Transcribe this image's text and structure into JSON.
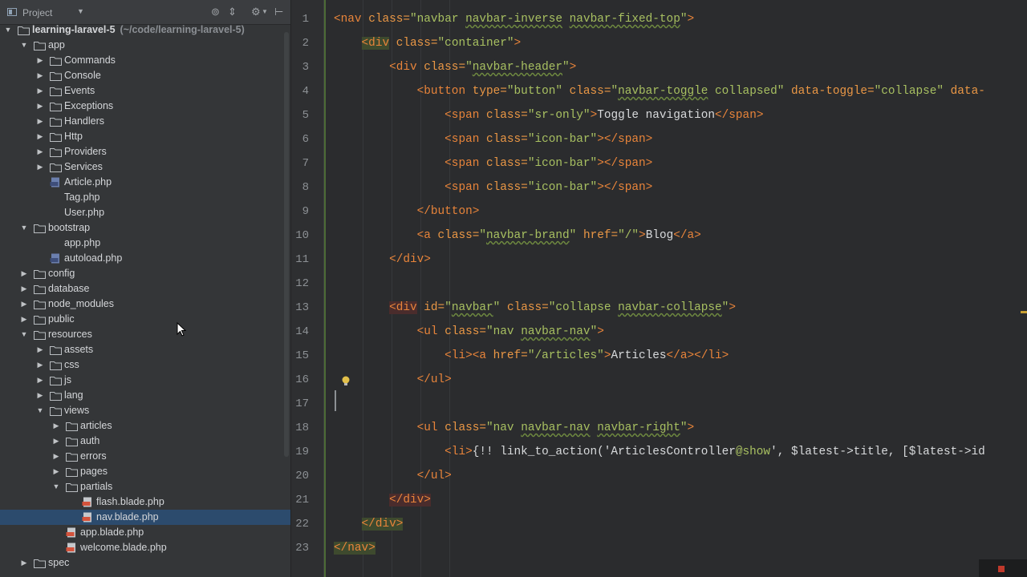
{
  "panel": {
    "title": "Project"
  },
  "tree": [
    {
      "label": "learning-laravel-5",
      "hint": "(~/code/learning-laravel-5)",
      "depth": 0,
      "arrow": "down",
      "icon": "folder",
      "bold": true
    },
    {
      "label": "app",
      "depth": 1,
      "arrow": "down",
      "icon": "folder"
    },
    {
      "label": "Commands",
      "depth": 2,
      "arrow": "right",
      "icon": "folder"
    },
    {
      "label": "Console",
      "depth": 2,
      "arrow": "right",
      "icon": "folder"
    },
    {
      "label": "Events",
      "depth": 2,
      "arrow": "right",
      "icon": "folder"
    },
    {
      "label": "Exceptions",
      "depth": 2,
      "arrow": "right",
      "icon": "folder"
    },
    {
      "label": "Handlers",
      "depth": 2,
      "arrow": "right",
      "icon": "folder"
    },
    {
      "label": "Http",
      "depth": 2,
      "arrow": "right",
      "icon": "folder"
    },
    {
      "label": "Providers",
      "depth": 2,
      "arrow": "right",
      "icon": "folder"
    },
    {
      "label": "Services",
      "depth": 2,
      "arrow": "right",
      "icon": "folder"
    },
    {
      "label": "Article.php",
      "depth": 2,
      "arrow": "",
      "icon": "php"
    },
    {
      "label": "Tag.php",
      "depth": 2,
      "arrow": "",
      "icon": ""
    },
    {
      "label": "User.php",
      "depth": 2,
      "arrow": "",
      "icon": ""
    },
    {
      "label": "bootstrap",
      "depth": 1,
      "arrow": "down",
      "icon": "folder"
    },
    {
      "label": "app.php",
      "depth": 2,
      "arrow": "",
      "icon": ""
    },
    {
      "label": "autoload.php",
      "depth": 2,
      "arrow": "",
      "icon": "php"
    },
    {
      "label": "config",
      "depth": 1,
      "arrow": "right",
      "icon": "folder"
    },
    {
      "label": "database",
      "depth": 1,
      "arrow": "right",
      "icon": "folder"
    },
    {
      "label": "node_modules",
      "depth": 1,
      "arrow": "right",
      "icon": "folder"
    },
    {
      "label": "public",
      "depth": 1,
      "arrow": "right",
      "icon": "folder"
    },
    {
      "label": "resources",
      "depth": 1,
      "arrow": "down",
      "icon": "folder"
    },
    {
      "label": "assets",
      "depth": 2,
      "arrow": "right",
      "icon": "folder"
    },
    {
      "label": "css",
      "depth": 2,
      "arrow": "right",
      "icon": "folder"
    },
    {
      "label": "js",
      "depth": 2,
      "arrow": "right",
      "icon": "folder"
    },
    {
      "label": "lang",
      "depth": 2,
      "arrow": "right",
      "icon": "folder"
    },
    {
      "label": "views",
      "depth": 2,
      "arrow": "down",
      "icon": "folder"
    },
    {
      "label": "articles",
      "depth": 3,
      "arrow": "right",
      "icon": "folder"
    },
    {
      "label": "auth",
      "depth": 3,
      "arrow": "right",
      "icon": "folder"
    },
    {
      "label": "errors",
      "depth": 3,
      "arrow": "right",
      "icon": "folder"
    },
    {
      "label": "pages",
      "depth": 3,
      "arrow": "right",
      "icon": "folder"
    },
    {
      "label": "partials",
      "depth": 3,
      "arrow": "down",
      "icon": "folder"
    },
    {
      "label": "flash.blade.php",
      "depth": 4,
      "arrow": "",
      "icon": "blade"
    },
    {
      "label": "nav.blade.php",
      "depth": 4,
      "arrow": "",
      "icon": "blade",
      "selected": true
    },
    {
      "label": "app.blade.php",
      "depth": 3,
      "arrow": "",
      "icon": "blade"
    },
    {
      "label": "welcome.blade.php",
      "depth": 3,
      "arrow": "",
      "icon": "blade"
    },
    {
      "label": "spec",
      "depth": 1,
      "arrow": "right",
      "icon": "folder"
    }
  ],
  "editor": {
    "line_numbers": [
      "1",
      "2",
      "3",
      "4",
      "5",
      "6",
      "7",
      "8",
      "9",
      "10",
      "11",
      "12",
      "13",
      "14",
      "15",
      "16",
      "17",
      "18",
      "19",
      "20",
      "21",
      "22",
      "23"
    ],
    "lines": [
      [
        [
          "tag",
          "<nav "
        ],
        [
          "attr",
          "class="
        ],
        [
          "val",
          "\"navbar "
        ],
        [
          "val",
          "navbar-inverse",
          "u"
        ],
        [
          "val",
          " "
        ],
        [
          "val",
          "navbar-fixed-top",
          "u"
        ],
        [
          "val",
          "\""
        ],
        [
          "tag",
          ">"
        ]
      ],
      [
        [
          "tag",
          "    <div",
          "hl-g"
        ],
        [
          "attr",
          " class="
        ],
        [
          "val",
          "\"container\""
        ],
        [
          "tag",
          ">"
        ]
      ],
      [
        [
          "tag",
          "        <div "
        ],
        [
          "attr",
          "class="
        ],
        [
          "val",
          "\""
        ],
        [
          "val",
          "navbar-header",
          "u"
        ],
        [
          "val",
          "\""
        ],
        [
          "tag",
          ">"
        ]
      ],
      [
        [
          "tag",
          "            <button "
        ],
        [
          "attr",
          "type="
        ],
        [
          "val",
          "\"button\" "
        ],
        [
          "attr",
          "class="
        ],
        [
          "val",
          "\""
        ],
        [
          "val",
          "navbar-toggle",
          "u"
        ],
        [
          "val",
          " collapsed\" "
        ],
        [
          "attr",
          "data-toggle="
        ],
        [
          "val",
          "\"collapse\" "
        ],
        [
          "attr",
          "data-"
        ]
      ],
      [
        [
          "tag",
          "                <span "
        ],
        [
          "attr",
          "class="
        ],
        [
          "val",
          "\"sr-only\""
        ],
        [
          "tag",
          ">"
        ],
        [
          "txt",
          "Toggle navigation"
        ],
        [
          "tag",
          "</span>"
        ]
      ],
      [
        [
          "tag",
          "                <span "
        ],
        [
          "attr",
          "class="
        ],
        [
          "val",
          "\"icon-bar\""
        ],
        [
          "tag",
          "></span>"
        ]
      ],
      [
        [
          "tag",
          "                <span "
        ],
        [
          "attr",
          "class="
        ],
        [
          "val",
          "\"icon-bar\""
        ],
        [
          "tag",
          "></span>"
        ]
      ],
      [
        [
          "tag",
          "                <span "
        ],
        [
          "attr",
          "class="
        ],
        [
          "val",
          "\"icon-bar\""
        ],
        [
          "tag",
          "></span>"
        ]
      ],
      [
        [
          "tag",
          "            </button>"
        ]
      ],
      [
        [
          "tag",
          "            <a "
        ],
        [
          "attr",
          "class="
        ],
        [
          "val",
          "\""
        ],
        [
          "val",
          "navbar-brand",
          "u"
        ],
        [
          "val",
          "\" "
        ],
        [
          "attr",
          "href="
        ],
        [
          "val",
          "\"/\""
        ],
        [
          "tag",
          ">"
        ],
        [
          "txt",
          "Blog"
        ],
        [
          "tag",
          "</a>"
        ]
      ],
      [
        [
          "tag",
          "        </div>"
        ]
      ],
      [
        [
          "txt",
          ""
        ]
      ],
      [
        [
          "tag",
          "        <div",
          "hl-r"
        ],
        [
          "attr",
          " id="
        ],
        [
          "val",
          "\""
        ],
        [
          "val",
          "navbar",
          "u"
        ],
        [
          "val",
          "\" "
        ],
        [
          "attr",
          "class="
        ],
        [
          "val",
          "\"collapse "
        ],
        [
          "val",
          "navbar-collapse",
          "u"
        ],
        [
          "val",
          "\""
        ],
        [
          "tag",
          ">"
        ]
      ],
      [
        [
          "tag",
          "            <ul "
        ],
        [
          "attr",
          "class="
        ],
        [
          "val",
          "\"nav "
        ],
        [
          "val",
          "navbar-nav",
          "u"
        ],
        [
          "val",
          "\""
        ],
        [
          "tag",
          ">"
        ]
      ],
      [
        [
          "tag",
          "                <li><a "
        ],
        [
          "attr",
          "href="
        ],
        [
          "val",
          "\"/articles\""
        ],
        [
          "tag",
          ">"
        ],
        [
          "txt",
          "Articles"
        ],
        [
          "tag",
          "</a></li>"
        ]
      ],
      [
        [
          "tag",
          "            </ul>"
        ]
      ],
      [
        [
          "txt",
          ""
        ]
      ],
      [
        [
          "tag",
          "            <ul "
        ],
        [
          "attr",
          "class="
        ],
        [
          "val",
          "\"nav "
        ],
        [
          "val",
          "navbar-nav",
          "u"
        ],
        [
          "val",
          " "
        ],
        [
          "val",
          "navbar-right",
          "u"
        ],
        [
          "val",
          "\""
        ],
        [
          "tag",
          ">"
        ]
      ],
      [
        [
          "tag",
          "                <li>"
        ],
        [
          "txt",
          "{!! link_to_action('ArticlesController"
        ],
        [
          "val",
          "@show"
        ],
        [
          "txt",
          "', $latest->title, [$latest->id"
        ]
      ],
      [
        [
          "tag",
          "            </ul>"
        ]
      ],
      [
        [
          "tag",
          "        </div>",
          "hl-r"
        ]
      ],
      [
        [
          "tag",
          "    </div>",
          "hl-g"
        ]
      ],
      [
        [
          "tag",
          "</nav>",
          "hl-g"
        ]
      ]
    ]
  }
}
